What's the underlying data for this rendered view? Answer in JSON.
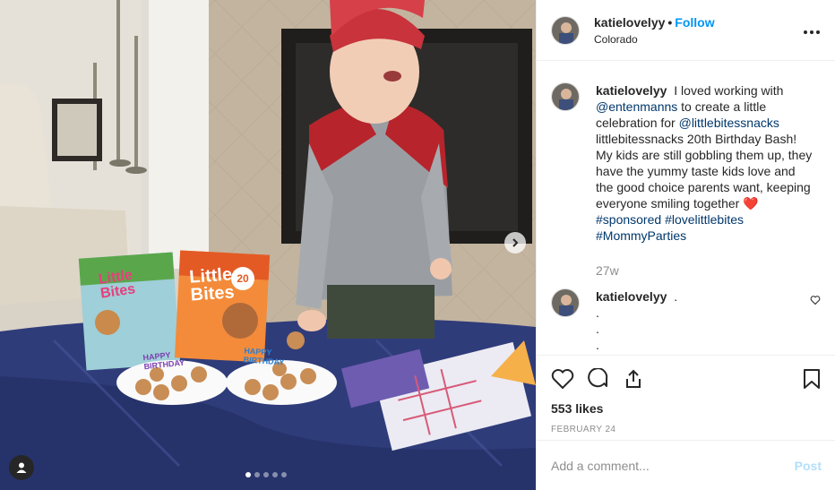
{
  "post": {
    "author": {
      "username": "katielovelyy",
      "separator": "•",
      "follow_label": "Follow",
      "location": "Colorado",
      "more_icon": "more-horizontal-icon"
    },
    "caption": {
      "username": "katielovelyy",
      "text_1": "I loved working with",
      "mention_1": "@entenmanns",
      "text_2": "to create a little celebration for",
      "mention_2": "@littlebitessnacks",
      "text_3": "littlebitessnacks 20th Birthday Bash! My kids are still gobbling them up, they have the yummy taste kids love and the good choice parents want, keeping everyone smiling together",
      "emoji": "❤️",
      "hashtag_1": "#sponsored",
      "hashtag_2": "#lovelittlebites",
      "hashtag_3": "#MommyParties",
      "age": "27w"
    },
    "comment": {
      "username": "katielovelyy",
      "line_1": ".",
      "line_2": ".",
      "line_3": ".",
      "line_4": "."
    },
    "likes": "553 likes",
    "date": "FEBRUARY 24",
    "add_comment_placeholder": "Add a comment...",
    "post_button_label": "Post",
    "carousel": {
      "slide_count": 5,
      "active_slide": 1
    },
    "photo": {
      "box_label_1": "Little",
      "box_label_2": "Bites",
      "box_count": "20",
      "banner_line_1": "HAPPY",
      "banner_line_2": "BIRTHDAY"
    },
    "colors": {
      "link": "#00376b",
      "follow": "#0095f6",
      "muted": "#8e8e8e",
      "heart": "#ed4956"
    }
  }
}
